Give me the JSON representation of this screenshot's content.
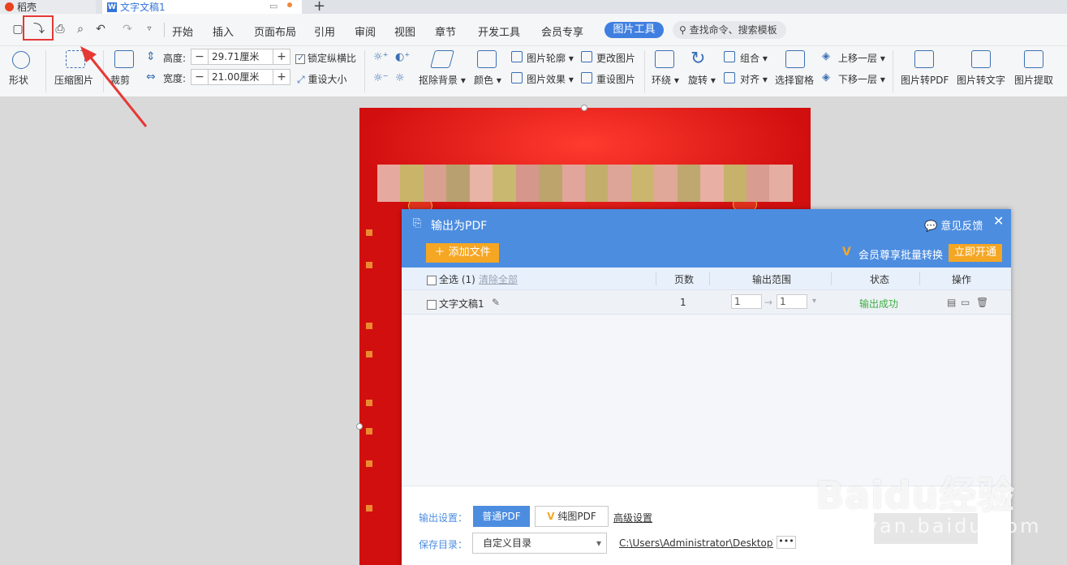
{
  "tabs": [
    {
      "label": "稻壳"
    },
    {
      "label": "文字文稿1"
    }
  ],
  "menu": [
    "开始",
    "插入",
    "页面布局",
    "引用",
    "审阅",
    "视图",
    "章节",
    "开发工具",
    "会员专享"
  ],
  "active_tab": "图片工具",
  "search_placeholder": "查找命令、搜索模板",
  "ribbon": {
    "shape": "形状",
    "compress": "压缩图片",
    "crop": "裁剪",
    "height_label": "高度:",
    "height_value": "29.71厘米",
    "width_label": "宽度:",
    "width_value": "21.00厘米",
    "lock_ratio": "锁定纵横比",
    "reset_size": "重设大小",
    "remove_bg": "抠除背景",
    "color": "颜色",
    "outline": "图片轮廓",
    "effect": "图片效果",
    "change_pic": "更改图片",
    "reset_pic": "重设图片",
    "wrap": "环绕",
    "rotate": "旋转",
    "group": "组合",
    "align": "对齐",
    "select_pane": "选择窗格",
    "bring_forward": "上移一层",
    "send_backward": "下移一层",
    "pic_to_pdf": "图片转PDF",
    "pic_to_text": "图片转文字",
    "pic_extract": "图片提取"
  },
  "dialog": {
    "title": "输出为PDF",
    "feedback": "意见反馈",
    "add_file": "添加文件",
    "vip_text": "会员尊享批量转换",
    "open_vip": "立即开通",
    "headers": {
      "select_all": "全选 (1)",
      "clear_all": "清除全部",
      "pages": "页数",
      "range": "输出范围",
      "status": "状态",
      "ops": "操作"
    },
    "rows": [
      {
        "name": "文字文稿1",
        "pages": "1",
        "from": "1",
        "to": "1",
        "status": "输出成功"
      }
    ],
    "output_settings_label": "输出设置：",
    "normal_pdf": "普通PDF",
    "pure_pdf": "纯图PDF",
    "advanced": "高级设置",
    "save_dir_label": "保存目录：",
    "save_dir_value": "自定义目录",
    "save_path": "C:\\Users\\Administrator\\Desktop\\",
    "more": "•••"
  },
  "watermark": {
    "brand": "Baidu经验",
    "url": "jingyan.baidu.com"
  },
  "colors": {
    "accent": "#4c8de0",
    "doc_red": "#d20f0f",
    "orange": "#f5a623",
    "annotation_red": "#e53935"
  }
}
